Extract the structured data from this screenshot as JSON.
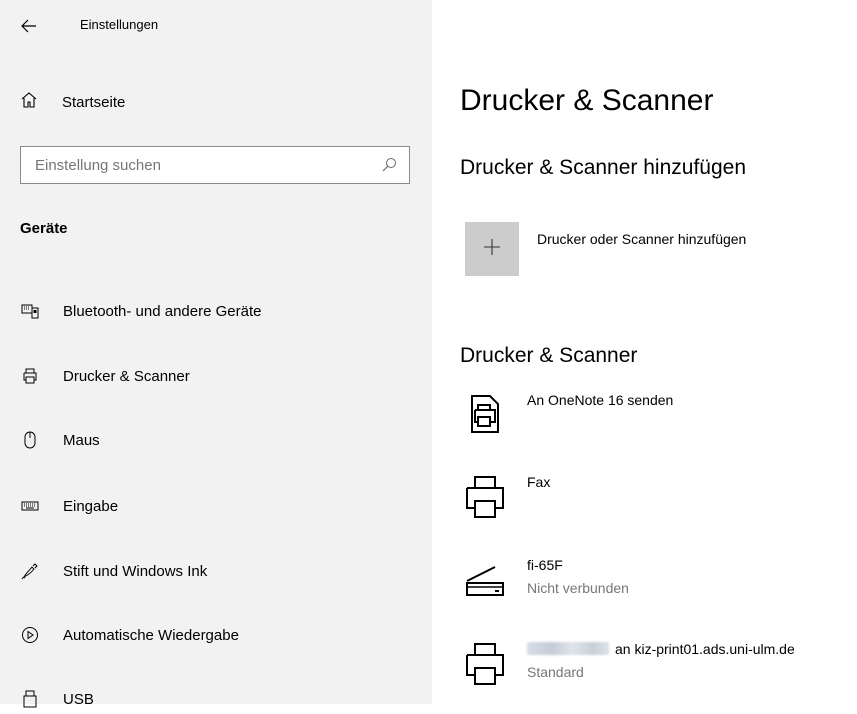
{
  "sidebar": {
    "back_icon": "arrow-left-icon",
    "app_title": "Einstellungen",
    "home_label": "Startseite",
    "search_placeholder": "Einstellung suchen",
    "section_title": "Geräte",
    "items": [
      {
        "label": "Bluetooth- und andere Geräte",
        "icon": "bluetooth-devices-icon"
      },
      {
        "label": "Drucker & Scanner",
        "icon": "printer-icon"
      },
      {
        "label": "Maus",
        "icon": "mouse-icon"
      },
      {
        "label": "Eingabe",
        "icon": "keyboard-icon"
      },
      {
        "label": "Stift und Windows Ink",
        "icon": "pen-icon"
      },
      {
        "label": "Automatische Wiedergabe",
        "icon": "autoplay-icon"
      },
      {
        "label": "USB",
        "icon": "usb-icon"
      }
    ]
  },
  "main": {
    "title": "Drucker & Scanner",
    "add_section_title": "Drucker & Scanner hinzufügen",
    "add_label": "Drucker oder Scanner hinzufügen",
    "list_title": "Drucker & Scanner",
    "devices": [
      {
        "name": "An OneNote 16 senden",
        "status": "",
        "icon": "onenote-printer-icon"
      },
      {
        "name": "Fax",
        "status": "",
        "icon": "printer-icon"
      },
      {
        "name": "fi-65F",
        "status": "Nicht verbunden",
        "icon": "scanner-icon"
      },
      {
        "name": "an kiz-print01.ads.uni-ulm.de",
        "status": "Standard",
        "icon": "printer-icon"
      }
    ]
  },
  "colors": {
    "sidebar_bg": "#f2f2f2",
    "add_button_bg": "#cccccc",
    "status_text": "#767676"
  }
}
